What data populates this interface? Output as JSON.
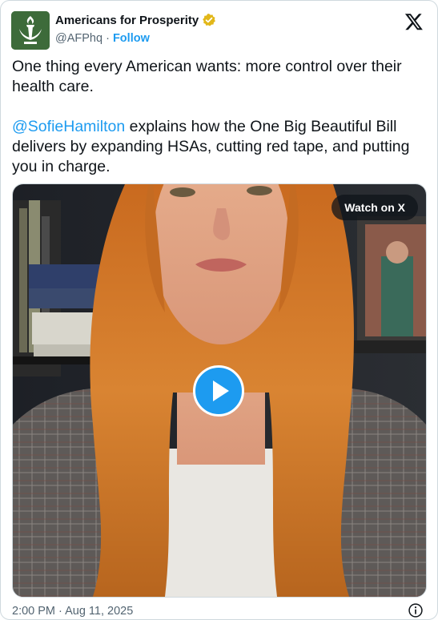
{
  "author": {
    "display_name": "Americans for Prosperity",
    "handle": "@AFPhq",
    "separator": " · ",
    "follow_label": "Follow",
    "avatar_icon": "torch-logo-icon",
    "verified_icon": "gold-verified-badge-icon",
    "brand_color": "#3d6b3a"
  },
  "platform_icon": "x-logo-icon",
  "tweet": {
    "paragraph1": "One thing every American wants: more control over their health care.",
    "mention": "@SofieHamilton",
    "paragraph2_rest": " explains how the One Big Beautiful Bill delivers by expanding HSAs, cutting red tape, and putting you in charge."
  },
  "media": {
    "type": "video",
    "watch_label": "Watch on X",
    "play_icon": "play-icon"
  },
  "footer": {
    "timestamp": "2:00 PM · Aug 11, 2025",
    "info_icon": "info-icon"
  },
  "colors": {
    "link": "#1d9bf0",
    "text": "#0f1419",
    "secondary": "#536471",
    "verified_gold": "#e2b719"
  }
}
